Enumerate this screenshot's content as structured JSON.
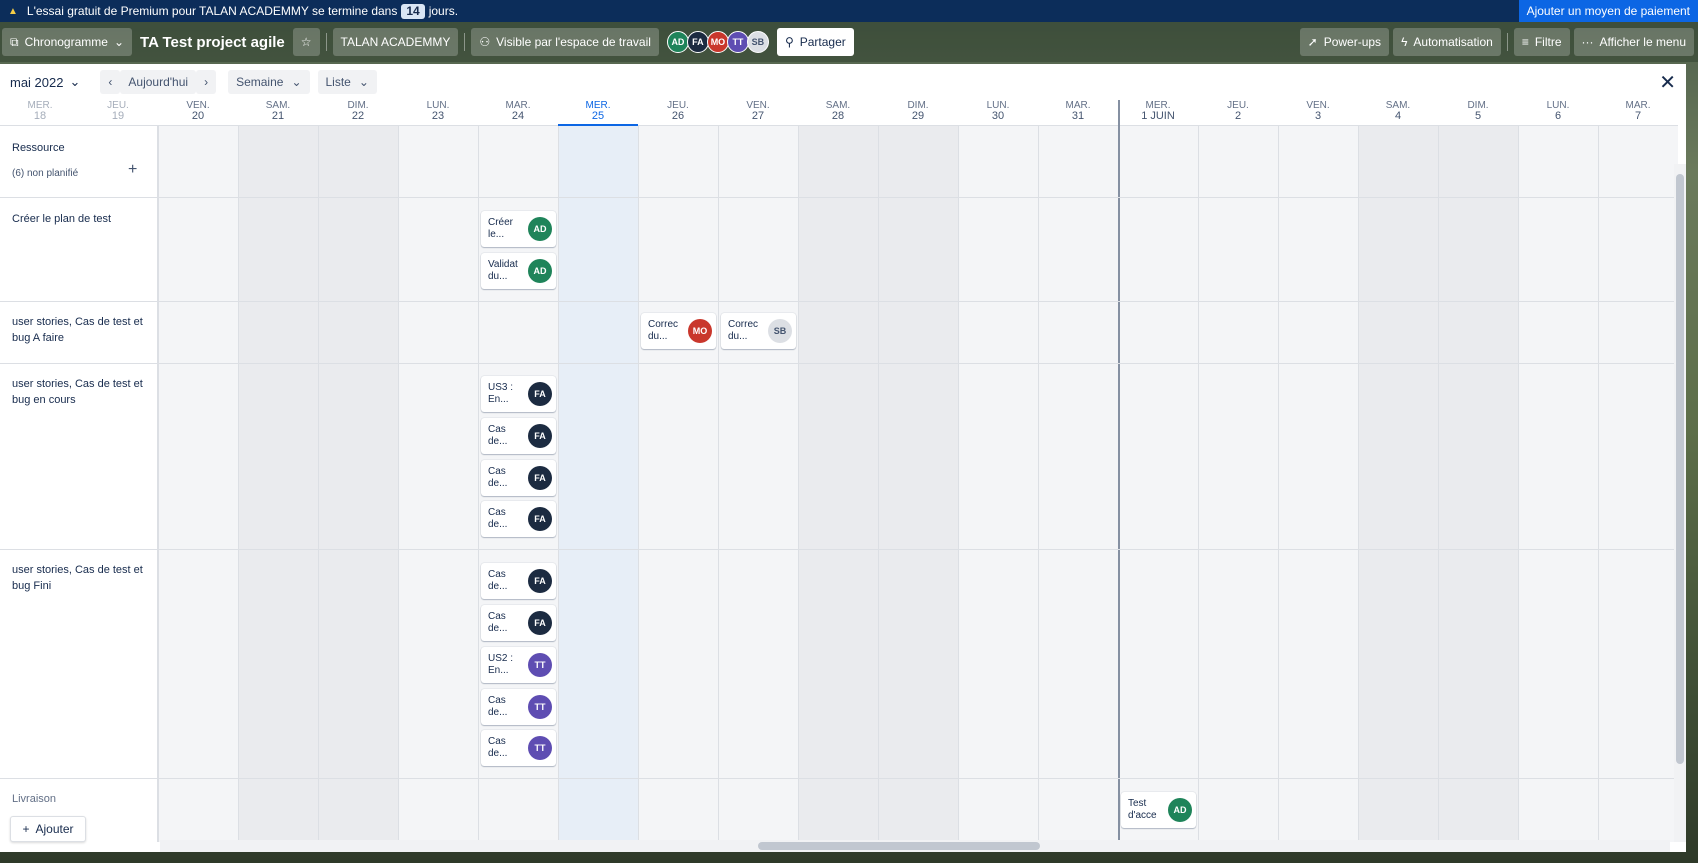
{
  "banner": {
    "text_before": "L'essai gratuit de Premium pour TALAN ACADEMMY se termine dans",
    "days": "14",
    "text_after": "jours.",
    "pay_button": "Ajouter un moyen de paiement"
  },
  "header": {
    "view_label": "Chronogramme",
    "board_title": "TA Test project agile",
    "workspace": "TALAN ACADEMMY",
    "visibility": "Visible par l'espace de travail",
    "share": "Partager",
    "powerups": "Power-ups",
    "automation": "Automatisation",
    "filter": "Filtre",
    "menu": "Afficher le menu",
    "members": [
      {
        "initials": "AD",
        "color": "#1f845a"
      },
      {
        "initials": "FA",
        "color": "#1c2b41"
      },
      {
        "initials": "MO",
        "color": "#c9372c"
      },
      {
        "initials": "TT",
        "color": "#5e4db2"
      },
      {
        "initials": "SB",
        "color": "#dcdfe4"
      }
    ]
  },
  "toolbar": {
    "month": "mai 2022",
    "today": "Aujourd'hui",
    "zoom": "Semaine",
    "group": "Liste"
  },
  "columns": [
    {
      "dow": "MER.",
      "day": "18"
    },
    {
      "dow": "JEU.",
      "day": "19"
    },
    {
      "dow": "VEN.",
      "day": "20"
    },
    {
      "dow": "SAM.",
      "day": "21"
    },
    {
      "dow": "DIM.",
      "day": "22"
    },
    {
      "dow": "LUN.",
      "day": "23"
    },
    {
      "dow": "MAR.",
      "day": "24"
    },
    {
      "dow": "MER.",
      "day": "25"
    },
    {
      "dow": "JEU.",
      "day": "26"
    },
    {
      "dow": "VEN.",
      "day": "27"
    },
    {
      "dow": "SAM.",
      "day": "28"
    },
    {
      "dow": "DIM.",
      "day": "29"
    },
    {
      "dow": "LUN.",
      "day": "30"
    },
    {
      "dow": "MAR.",
      "day": "31"
    },
    {
      "dow": "MER.",
      "day": "1 JUIN"
    },
    {
      "dow": "JEU.",
      "day": "2"
    },
    {
      "dow": "VEN.",
      "day": "3"
    },
    {
      "dow": "SAM.",
      "day": "4"
    },
    {
      "dow": "DIM.",
      "day": "5"
    },
    {
      "dow": "LUN.",
      "day": "6"
    },
    {
      "dow": "MAR.",
      "day": "7"
    }
  ],
  "rows": {
    "resource": "Ressource",
    "unplanned": "(6) non planifié",
    "r1": "Créer le plan de test",
    "r2": "user stories, Cas de test et bug A faire",
    "r3": "user stories, Cas de test et bug en cours",
    "r4": "user stories, Cas de test et bug Fini",
    "r5": "Livraison",
    "add": "Ajouter"
  },
  "cards": {
    "c1": {
      "title": "Créer le...",
      "member": "AD"
    },
    "c2": {
      "title": "Validat du...",
      "member": "AD"
    },
    "c3": {
      "title": "Correc du...",
      "member": "MO"
    },
    "c4": {
      "title": "Correc du...",
      "member": "SB"
    },
    "c5": {
      "title": "US3 : En...",
      "member": "FA"
    },
    "c6": {
      "title": "Cas de...",
      "member": "FA"
    },
    "c7": {
      "title": "Cas de...",
      "member": "FA"
    },
    "c8": {
      "title": "Cas de...",
      "member": "FA"
    },
    "c9": {
      "title": "Cas de...",
      "member": "FA"
    },
    "c10": {
      "title": "Cas de...",
      "member": "FA"
    },
    "c11": {
      "title": "US2 : En...",
      "member": "TT"
    },
    "c12": {
      "title": "Cas de...",
      "member": "TT"
    },
    "c13": {
      "title": "Cas de...",
      "member": "TT"
    },
    "c14": {
      "title": "Test d'acce",
      "member": "AD"
    }
  }
}
